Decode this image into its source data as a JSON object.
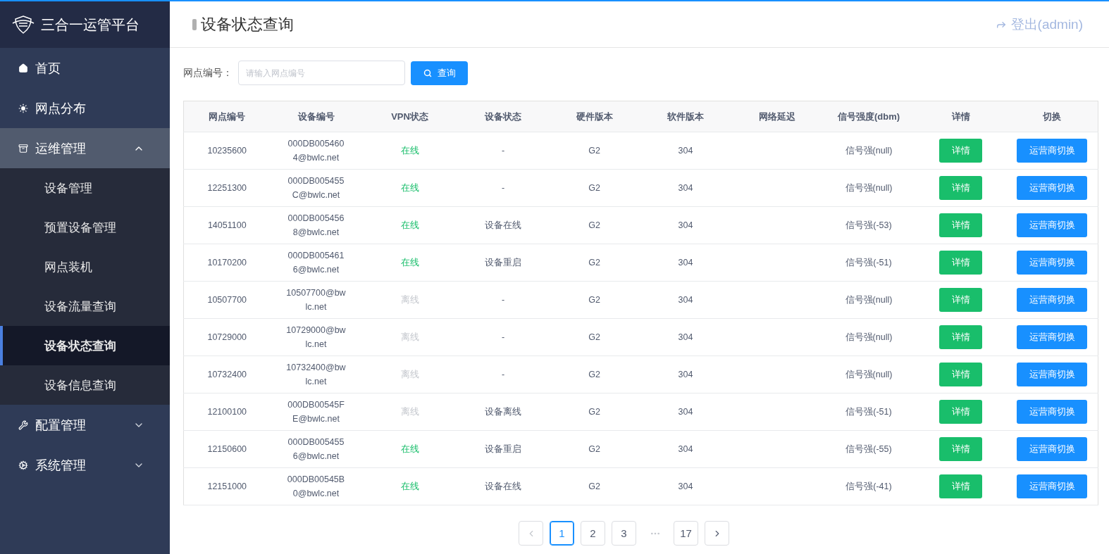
{
  "sidebar": {
    "title": "三合一运管平台",
    "items": [
      {
        "label": "首页",
        "has_submenu": false
      },
      {
        "label": "网点分布",
        "has_submenu": false
      },
      {
        "label": "运维管理",
        "has_submenu": true,
        "expanded": true,
        "children": [
          {
            "label": "设备管理",
            "selected": false
          },
          {
            "label": "预置设备管理",
            "selected": false
          },
          {
            "label": "网点装机",
            "selected": false
          },
          {
            "label": "设备流量查询",
            "selected": false
          },
          {
            "label": "设备状态查询",
            "selected": true
          },
          {
            "label": "设备信息查询",
            "selected": false
          }
        ]
      },
      {
        "label": "配置管理",
        "has_submenu": true,
        "expanded": false
      },
      {
        "label": "系统管理",
        "has_submenu": true,
        "expanded": false
      }
    ]
  },
  "header": {
    "title": "设备状态查询",
    "logout": "登出(admin)"
  },
  "search": {
    "label": "网点编号：",
    "placeholder": "请输入网点编号",
    "button": "查询"
  },
  "table": {
    "columns": [
      "网点编号",
      "设备编号",
      "VPN状态",
      "设备状态",
      "硬件版本",
      "软件版本",
      "网络延迟",
      "信号强度(dbm)",
      "详情",
      "切换"
    ],
    "rows": [
      {
        "site": "10235600",
        "device": "000DB0054604@bwlc.net",
        "vpn": "在线",
        "online": true,
        "status": "-",
        "hw": "G2",
        "sw": "304",
        "signal": "信号强(null)",
        "detail": "详情",
        "switch": "运营商切换"
      },
      {
        "site": "12251300",
        "device": "000DB005455C@bwlc.net",
        "vpn": "在线",
        "online": true,
        "status": "-",
        "hw": "G2",
        "sw": "304",
        "signal": "信号强(null)",
        "detail": "详情",
        "switch": "运营商切换"
      },
      {
        "site": "14051100",
        "device": "000DB0054568@bwlc.net",
        "vpn": "在线",
        "online": true,
        "status": "设备在线",
        "hw": "G2",
        "sw": "304",
        "signal": "信号强(-53)",
        "detail": "详情",
        "switch": "运营商切换"
      },
      {
        "site": "10170200",
        "device": "000DB0054616@bwlc.net",
        "vpn": "在线",
        "online": true,
        "status": "设备重启",
        "hw": "G2",
        "sw": "304",
        "signal": "信号强(-51)",
        "detail": "详情",
        "switch": "运营商切换"
      },
      {
        "site": "10507700",
        "device": "10507700@bwlc.net",
        "vpn": "离线",
        "online": false,
        "status": "-",
        "hw": "G2",
        "sw": "304",
        "signal": "信号强(null)",
        "detail": "详情",
        "switch": "运营商切换"
      },
      {
        "site": "10729000",
        "device": "10729000@bwlc.net",
        "vpn": "离线",
        "online": false,
        "status": "-",
        "hw": "G2",
        "sw": "304",
        "signal": "信号强(null)",
        "detail": "详情",
        "switch": "运营商切换"
      },
      {
        "site": "10732400",
        "device": "10732400@bwlc.net",
        "vpn": "离线",
        "online": false,
        "status": "-",
        "hw": "G2",
        "sw": "304",
        "signal": "信号强(null)",
        "detail": "详情",
        "switch": "运营商切换"
      },
      {
        "site": "12100100",
        "device": "000DB00545FE@bwlc.net",
        "vpn": "离线",
        "online": false,
        "status": "设备离线",
        "hw": "G2",
        "sw": "304",
        "signal": "信号强(-51)",
        "detail": "详情",
        "switch": "运营商切换"
      },
      {
        "site": "12150600",
        "device": "000DB0054556@bwlc.net",
        "vpn": "在线",
        "online": true,
        "status": "设备重启",
        "hw": "G2",
        "sw": "304",
        "signal": "信号强(-55)",
        "detail": "详情",
        "switch": "运营商切换"
      },
      {
        "site": "12151000",
        "device": "000DB00545B0@bwlc.net",
        "vpn": "在线",
        "online": true,
        "status": "设备在线",
        "hw": "G2",
        "sw": "304",
        "signal": "信号强(-41)",
        "detail": "详情",
        "switch": "运营商切换"
      }
    ]
  },
  "pagination": {
    "prev_disabled": true,
    "next_disabled": false,
    "pages": [
      {
        "kind": "page",
        "label": "1",
        "selected": true
      },
      {
        "kind": "page",
        "label": "2",
        "selected": false
      },
      {
        "kind": "page",
        "label": "3",
        "selected": false
      },
      {
        "kind": "ellipsis"
      },
      {
        "kind": "page",
        "label": "17",
        "selected": false
      }
    ]
  }
}
